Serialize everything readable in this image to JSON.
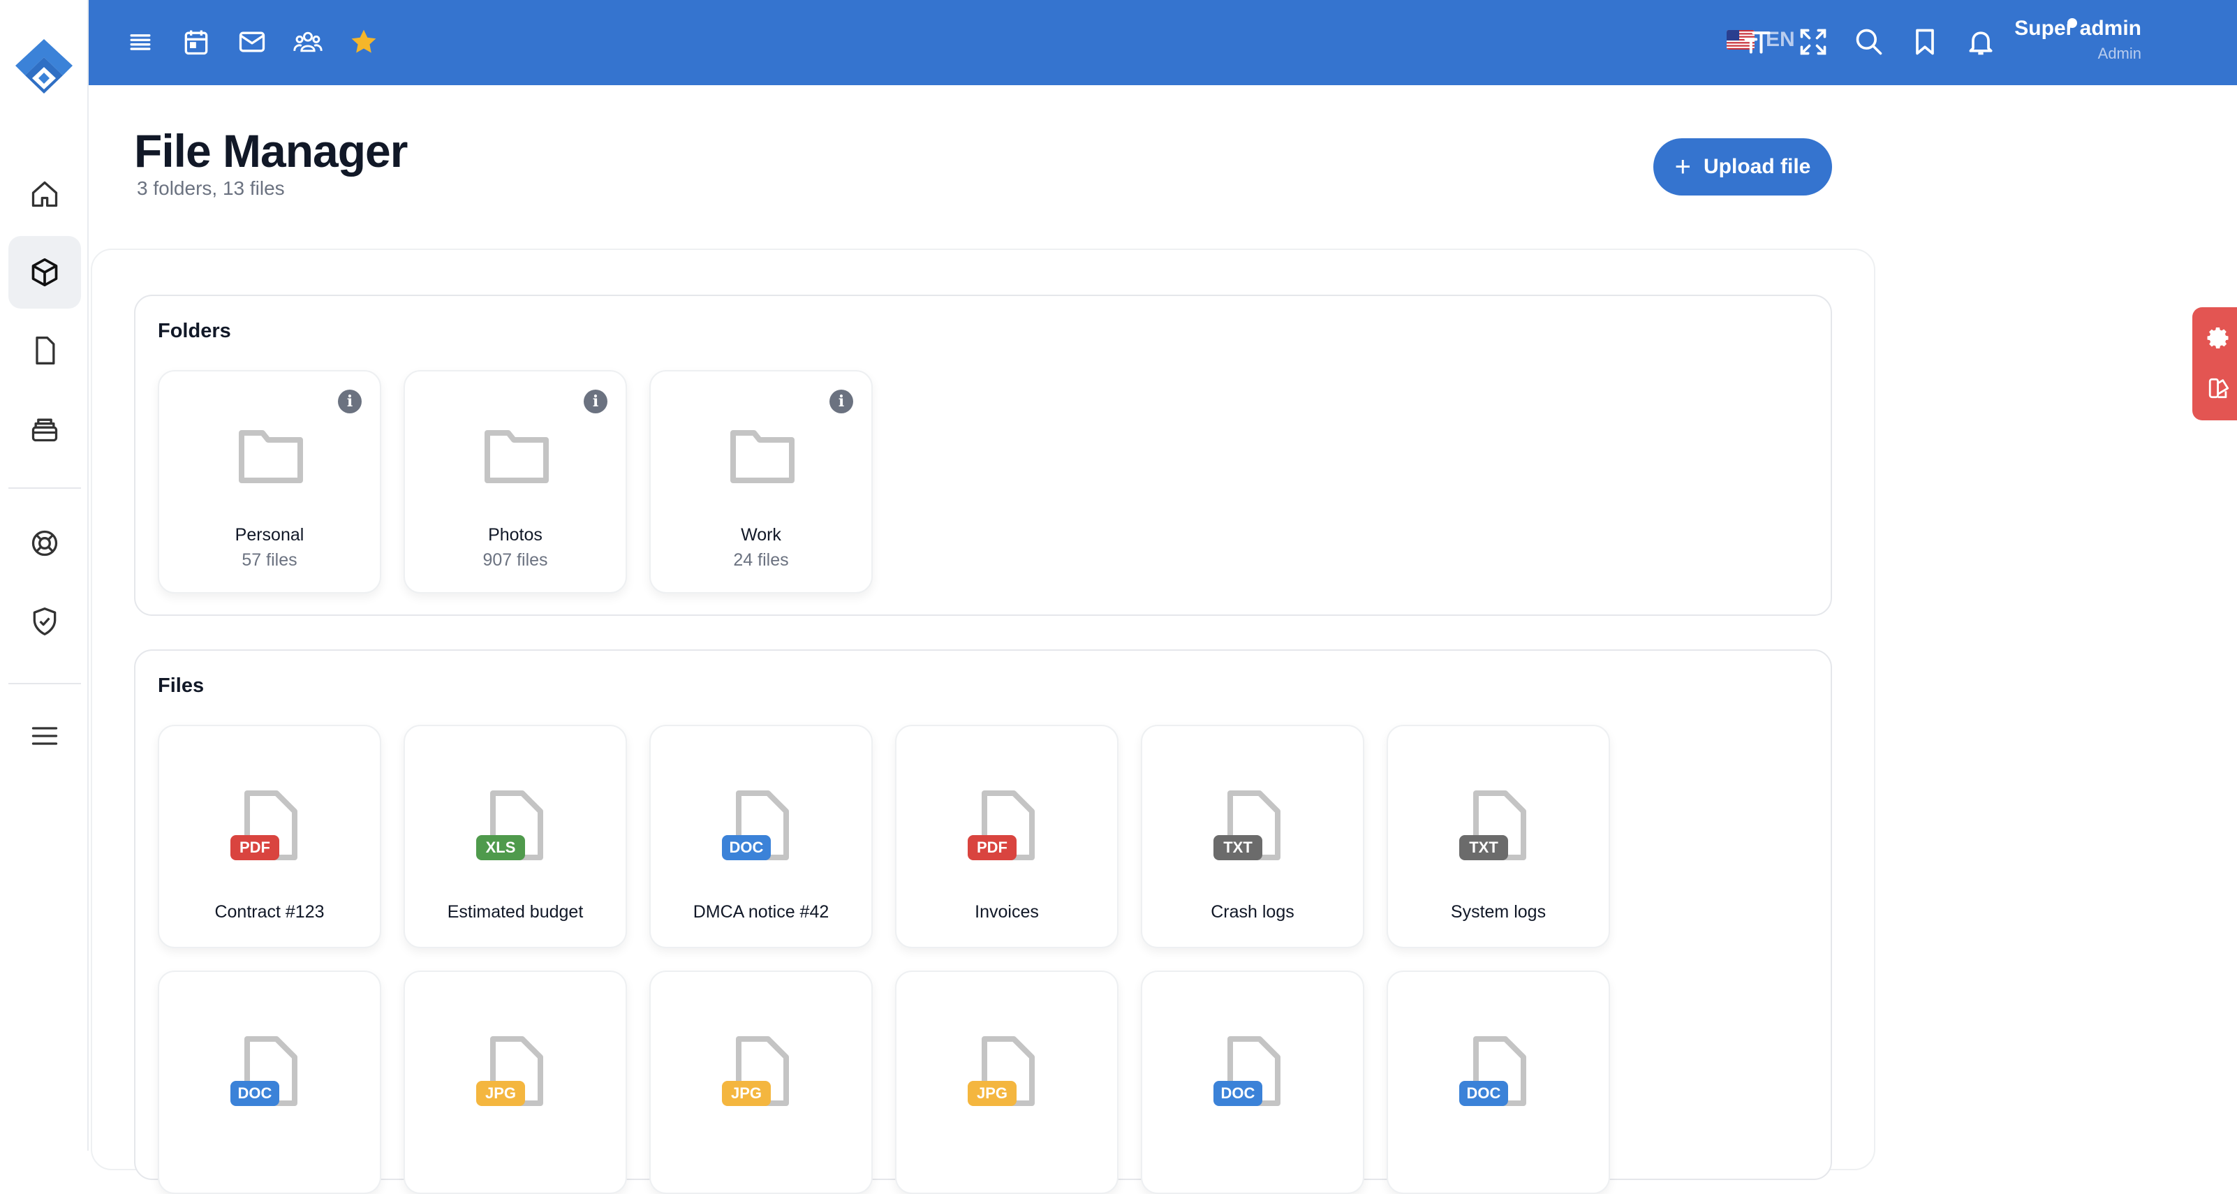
{
  "topbar": {
    "language": "EN",
    "user_name": "Super admin",
    "user_role": "Admin",
    "icons": [
      "menu-icon",
      "calendar-icon",
      "mail-icon",
      "users-icon",
      "star-icon",
      "text-size-icon",
      "fullscreen-icon",
      "search-icon",
      "bookmark-icon",
      "bell-icon"
    ]
  },
  "sidebar": {
    "items": [
      "home",
      "products",
      "documents",
      "storage",
      "support",
      "security",
      "menu"
    ]
  },
  "page": {
    "title": "File Manager",
    "subtitle": "3 folders, 13 files",
    "upload_label": "Upload file"
  },
  "folders": {
    "title": "Folders",
    "items": [
      {
        "name": "Personal",
        "count": "57 files"
      },
      {
        "name": "Photos",
        "count": "907 files"
      },
      {
        "name": "Work",
        "count": "24 files"
      }
    ]
  },
  "files": {
    "title": "Files",
    "items": [
      {
        "name": "Contract #123",
        "type": "PDF",
        "color": "#d9443f"
      },
      {
        "name": "Estimated budget",
        "type": "XLS",
        "color": "#4f9a4c"
      },
      {
        "name": "DMCA notice #42",
        "type": "DOC",
        "color": "#3b82d8"
      },
      {
        "name": "Invoices",
        "type": "PDF",
        "color": "#d9443f"
      },
      {
        "name": "Crash logs",
        "type": "TXT",
        "color": "#6b6b6b"
      },
      {
        "name": "System logs",
        "type": "TXT",
        "color": "#6b6b6b"
      },
      {
        "name": "",
        "type": "DOC",
        "color": "#3b82d8"
      },
      {
        "name": "",
        "type": "JPG",
        "color": "#f4b63f"
      },
      {
        "name": "",
        "type": "JPG",
        "color": "#f4b63f"
      },
      {
        "name": "",
        "type": "JPG",
        "color": "#f4b63f"
      },
      {
        "name": "",
        "type": "DOC",
        "color": "#3b82d8"
      },
      {
        "name": "",
        "type": "DOC",
        "color": "#3b82d8"
      }
    ]
  },
  "colors": {
    "primary": "#3574cf",
    "accent_star": "#f5b62a",
    "settings_tab": "#e35552"
  }
}
